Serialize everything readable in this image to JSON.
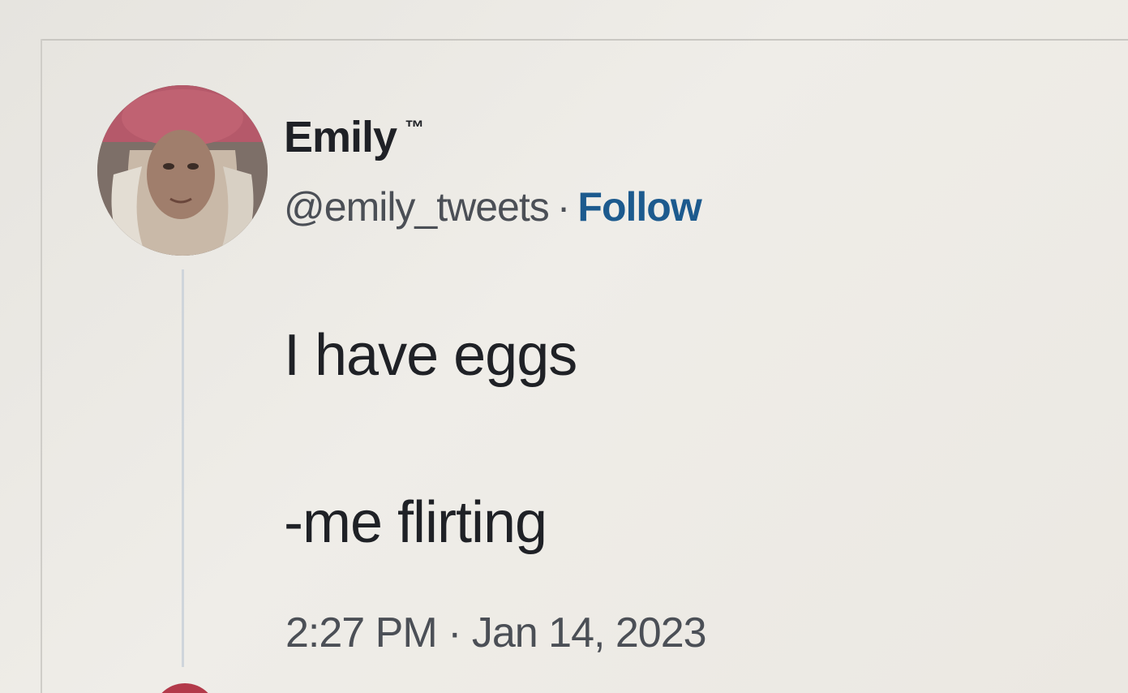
{
  "tweet": {
    "display_name": "Emily",
    "badge": "™",
    "handle": "@emily_tweets",
    "separator": "·",
    "follow_label": "Follow",
    "body_line_1": "I have eggs",
    "body_line_2": "-me flirting",
    "timestamp": "2:27 PM · Jan 14, 2023"
  },
  "colors": {
    "follow": "#1c5a8e",
    "text": "#1f2126",
    "secondary_text": "#4b4f56",
    "thread_line": "#cfd5db"
  }
}
